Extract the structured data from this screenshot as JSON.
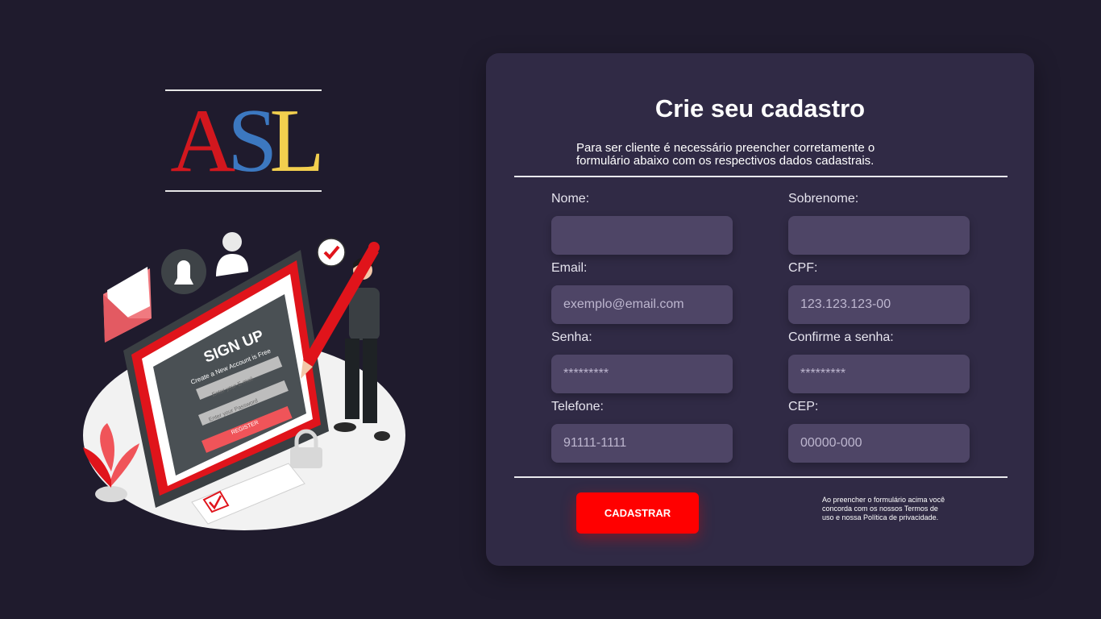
{
  "logo": {
    "letters": [
      "A",
      "S",
      "L"
    ]
  },
  "illustration": {
    "heading": "SIGN UP",
    "subheading": "Create a New Account is Free",
    "email_placeholder": "Enter your E-mail",
    "password_placeholder": "Enter your Password",
    "register_label": "REGISTER"
  },
  "form": {
    "title": "Crie seu cadastro",
    "subtitle": "Para ser cliente é necessário preencher corretamente o formulário abaixo com os respectivos dados cadastrais.",
    "fields": [
      {
        "label": "Nome:",
        "placeholder": ""
      },
      {
        "label": "Sobrenome:",
        "placeholder": ""
      },
      {
        "label": "Email:",
        "placeholder": "exemplo@email.com"
      },
      {
        "label": "CPF:",
        "placeholder": "123.123.123-00"
      },
      {
        "label": "Senha:",
        "placeholder": "*********"
      },
      {
        "label": "Confirme a senha:",
        "placeholder": "*********"
      },
      {
        "label": "Telefone:",
        "placeholder": "91111-1111"
      },
      {
        "label": "CEP:",
        "placeholder": "00000-000"
      }
    ],
    "submit_label": "CADASTRAR",
    "terms_text": "Ao preencher o formulário acima você concorda com os nossos Termos de uso e nossa Política de privacidade."
  },
  "colors": {
    "background": "#1f1b2d",
    "card": "#302a45",
    "input": "#4e4566",
    "accent": "#ff0000"
  }
}
